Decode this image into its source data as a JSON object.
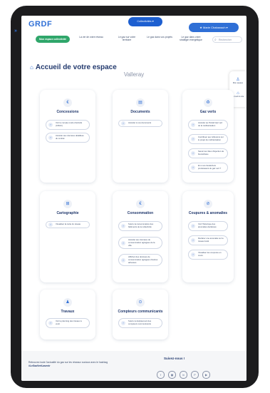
{
  "header": {
    "logo": "GRDF",
    "logo_sub": "",
    "top_pill": "Collectivités ▾",
    "user_pill": "★ Marie Chabanach ▾",
    "search_placeholder": "Rechercher",
    "nav": [
      {
        "label": "Mon espace collectivité",
        "active": true
      },
      {
        "label": "La vie de votre réseau"
      },
      {
        "label": "Le gaz sur votre territoire"
      },
      {
        "label": "Le gaz dans vos projets"
      },
      {
        "label": "Le gaz dans votre stratégie énergétique"
      }
    ]
  },
  "side_sliver": "»",
  "float_panel": {
    "item1": "Mon espace",
    "item2": "Accueil du site"
  },
  "page": {
    "title": "Accueil de votre espace",
    "commune": "Valleray"
  },
  "cards": {
    "concessions": {
      "icon": "€",
      "title": "Concessions",
      "links": [
        "Voir le compte rendu d'activité (CRAC)",
        "Accéder aux données détaillées du contrat"
      ]
    },
    "documents": {
      "icon": "▤",
      "title": "Documents",
      "links": [
        "Accéder à vos documents"
      ]
    },
    "gaz_verts": {
      "icon": "♻",
      "title": "Gaz verts",
      "links": [
        "Accéder au Portail Gaz vert de la méthanisation",
        "Contribuer aux réflexions sur le projet de méthanisation",
        "Savoir les rôles d'injection de biométhane",
        "Et si vos biodéchets produisaient du gaz vert ?"
      ]
    },
    "cartographie": {
      "icon": "⊞",
      "title": "Cartographie",
      "links": [
        "Visualiser la carte du réseau"
      ]
    },
    "consommation": {
      "icon": "€",
      "title": "Consommation",
      "links": [
        "Suivre la consommation des bâtiments de la collectivité",
        "Accéder aux données de consommation agrégées de la ville",
        "Affichez des données de consommation agrégées d'autres adresses"
      ]
    },
    "coupures": {
      "icon": "⊘",
      "title": "Coupures & anomalies",
      "links": [
        "Voir l'historique des anomalies déclarées",
        "Déclarer une anomalie sur le réseau local",
        "Visualiser les coupures en cours"
      ]
    },
    "travaux": {
      "icon": "♟",
      "title": "Travaux",
      "links": [
        "Voir le planning des travaux à venir"
      ]
    },
    "compteurs": {
      "icon": "⊙",
      "title": "Compteurs communicants",
      "links": [
        "Suivre le déploiement des compteurs communicants"
      ]
    }
  },
  "footer": {
    "text": "Retrouvez toute l'actualité du gaz sur les réseaux sociaux avec le hashtag",
    "hashtag": "#LeGazVertLavenir",
    "follow": "Suivez-nous !",
    "socials": [
      "f",
      "▣",
      "in",
      "P",
      "▶"
    ]
  }
}
